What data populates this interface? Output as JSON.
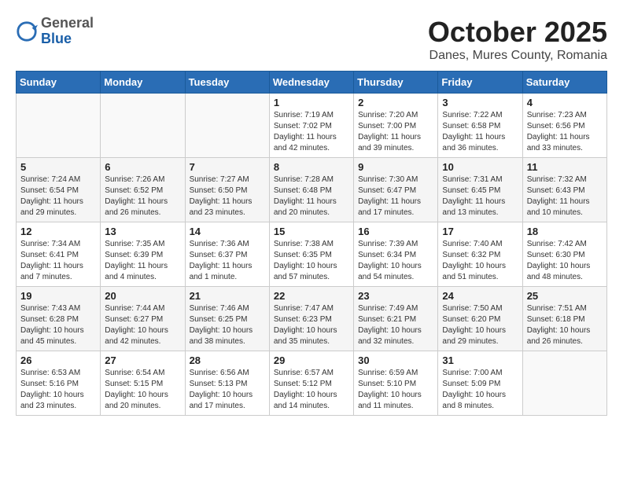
{
  "header": {
    "logo_general": "General",
    "logo_blue": "Blue",
    "month": "October 2025",
    "location": "Danes, Mures County, Romania"
  },
  "weekdays": [
    "Sunday",
    "Monday",
    "Tuesday",
    "Wednesday",
    "Thursday",
    "Friday",
    "Saturday"
  ],
  "weeks": [
    [
      {
        "day": "",
        "info": ""
      },
      {
        "day": "",
        "info": ""
      },
      {
        "day": "",
        "info": ""
      },
      {
        "day": "1",
        "info": "Sunrise: 7:19 AM\nSunset: 7:02 PM\nDaylight: 11 hours\nand 42 minutes."
      },
      {
        "day": "2",
        "info": "Sunrise: 7:20 AM\nSunset: 7:00 PM\nDaylight: 11 hours\nand 39 minutes."
      },
      {
        "day": "3",
        "info": "Sunrise: 7:22 AM\nSunset: 6:58 PM\nDaylight: 11 hours\nand 36 minutes."
      },
      {
        "day": "4",
        "info": "Sunrise: 7:23 AM\nSunset: 6:56 PM\nDaylight: 11 hours\nand 33 minutes."
      }
    ],
    [
      {
        "day": "5",
        "info": "Sunrise: 7:24 AM\nSunset: 6:54 PM\nDaylight: 11 hours\nand 29 minutes."
      },
      {
        "day": "6",
        "info": "Sunrise: 7:26 AM\nSunset: 6:52 PM\nDaylight: 11 hours\nand 26 minutes."
      },
      {
        "day": "7",
        "info": "Sunrise: 7:27 AM\nSunset: 6:50 PM\nDaylight: 11 hours\nand 23 minutes."
      },
      {
        "day": "8",
        "info": "Sunrise: 7:28 AM\nSunset: 6:48 PM\nDaylight: 11 hours\nand 20 minutes."
      },
      {
        "day": "9",
        "info": "Sunrise: 7:30 AM\nSunset: 6:47 PM\nDaylight: 11 hours\nand 17 minutes."
      },
      {
        "day": "10",
        "info": "Sunrise: 7:31 AM\nSunset: 6:45 PM\nDaylight: 11 hours\nand 13 minutes."
      },
      {
        "day": "11",
        "info": "Sunrise: 7:32 AM\nSunset: 6:43 PM\nDaylight: 11 hours\nand 10 minutes."
      }
    ],
    [
      {
        "day": "12",
        "info": "Sunrise: 7:34 AM\nSunset: 6:41 PM\nDaylight: 11 hours\nand 7 minutes."
      },
      {
        "day": "13",
        "info": "Sunrise: 7:35 AM\nSunset: 6:39 PM\nDaylight: 11 hours\nand 4 minutes."
      },
      {
        "day": "14",
        "info": "Sunrise: 7:36 AM\nSunset: 6:37 PM\nDaylight: 11 hours\nand 1 minute."
      },
      {
        "day": "15",
        "info": "Sunrise: 7:38 AM\nSunset: 6:35 PM\nDaylight: 10 hours\nand 57 minutes."
      },
      {
        "day": "16",
        "info": "Sunrise: 7:39 AM\nSunset: 6:34 PM\nDaylight: 10 hours\nand 54 minutes."
      },
      {
        "day": "17",
        "info": "Sunrise: 7:40 AM\nSunset: 6:32 PM\nDaylight: 10 hours\nand 51 minutes."
      },
      {
        "day": "18",
        "info": "Sunrise: 7:42 AM\nSunset: 6:30 PM\nDaylight: 10 hours\nand 48 minutes."
      }
    ],
    [
      {
        "day": "19",
        "info": "Sunrise: 7:43 AM\nSunset: 6:28 PM\nDaylight: 10 hours\nand 45 minutes."
      },
      {
        "day": "20",
        "info": "Sunrise: 7:44 AM\nSunset: 6:27 PM\nDaylight: 10 hours\nand 42 minutes."
      },
      {
        "day": "21",
        "info": "Sunrise: 7:46 AM\nSunset: 6:25 PM\nDaylight: 10 hours\nand 38 minutes."
      },
      {
        "day": "22",
        "info": "Sunrise: 7:47 AM\nSunset: 6:23 PM\nDaylight: 10 hours\nand 35 minutes."
      },
      {
        "day": "23",
        "info": "Sunrise: 7:49 AM\nSunset: 6:21 PM\nDaylight: 10 hours\nand 32 minutes."
      },
      {
        "day": "24",
        "info": "Sunrise: 7:50 AM\nSunset: 6:20 PM\nDaylight: 10 hours\nand 29 minutes."
      },
      {
        "day": "25",
        "info": "Sunrise: 7:51 AM\nSunset: 6:18 PM\nDaylight: 10 hours\nand 26 minutes."
      }
    ],
    [
      {
        "day": "26",
        "info": "Sunrise: 6:53 AM\nSunset: 5:16 PM\nDaylight: 10 hours\nand 23 minutes."
      },
      {
        "day": "27",
        "info": "Sunrise: 6:54 AM\nSunset: 5:15 PM\nDaylight: 10 hours\nand 20 minutes."
      },
      {
        "day": "28",
        "info": "Sunrise: 6:56 AM\nSunset: 5:13 PM\nDaylight: 10 hours\nand 17 minutes."
      },
      {
        "day": "29",
        "info": "Sunrise: 6:57 AM\nSunset: 5:12 PM\nDaylight: 10 hours\nand 14 minutes."
      },
      {
        "day": "30",
        "info": "Sunrise: 6:59 AM\nSunset: 5:10 PM\nDaylight: 10 hours\nand 11 minutes."
      },
      {
        "day": "31",
        "info": "Sunrise: 7:00 AM\nSunset: 5:09 PM\nDaylight: 10 hours\nand 8 minutes."
      },
      {
        "day": "",
        "info": ""
      }
    ]
  ]
}
